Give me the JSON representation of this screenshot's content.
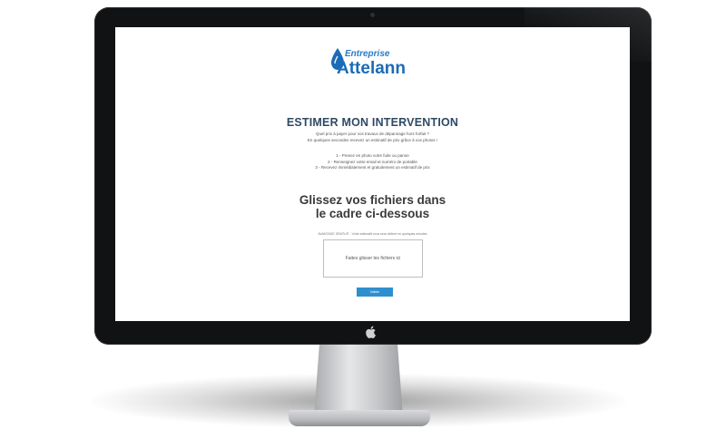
{
  "logo": {
    "top_text": "Entreprise",
    "main_text": "Attelann"
  },
  "page": {
    "title": "ESTIMER MON INTERVENTION",
    "intro_lines": [
      "Quel prix à payer pour vos travaux de dépannage hors forfait ?",
      "En quelques secondes recevez un estimatif de prix grâce à vos photos !"
    ],
    "steps": [
      "1 - Prenez en photo votre fuite ou panne",
      "2 - Renseignez votre email et numéro de portable",
      "3 - Recevez immédiatement et gratuitement un estimatif de prix"
    ],
    "headline_lines": [
      "Glissez vos fichiers dans",
      "le cadre ci-dessous"
    ],
    "note": "AVANTAGE GRATUIT : Votre estimatif vous sera délivré en quelques minutes",
    "dropzone_label": "Faites glisser les fichiers ici",
    "submit_label": "Valider"
  },
  "colors": {
    "brand_blue": "#1b6bb6",
    "button_blue": "#2e8fce",
    "title_color": "#2f4a64"
  },
  "icons": {
    "logo": "water-drop-icon",
    "device": "apple-logo-icon"
  }
}
